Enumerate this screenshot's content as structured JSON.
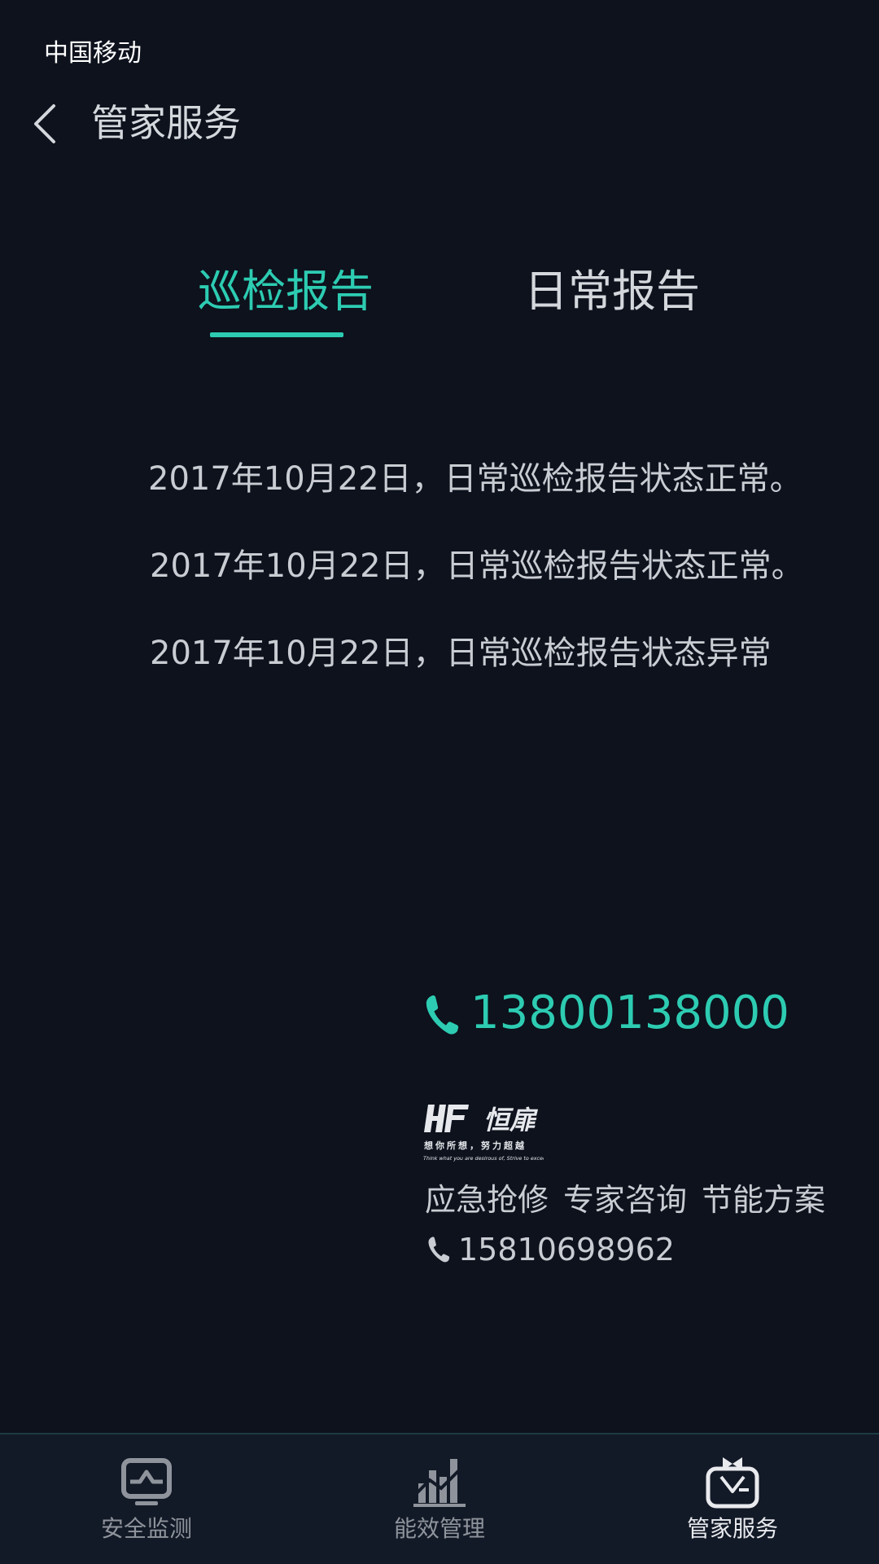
{
  "status_bar": {
    "carrier": "中国移动"
  },
  "header": {
    "title": "管家服务",
    "back_icon": "chevron-left-icon"
  },
  "tabs": [
    {
      "label": "巡检报告",
      "active": true
    },
    {
      "label": "日常报告",
      "active": false
    }
  ],
  "reports": [
    "2017年10月22日，日常巡检报告状态正常。",
    "2017年10月22日，日常巡检报告状态正常。",
    "2017年10月22日，日常巡检报告状态异常"
  ],
  "hotline": {
    "icon": "phone-icon",
    "number": "13800138000"
  },
  "company": {
    "logo_text": "恒扉",
    "slogan": "想你所想，努力超越",
    "slogan_en": "Think what you are desirous of, Strive to exceed",
    "services": [
      "应急抢修",
      "专家咨询",
      "节能方案"
    ],
    "phone": "15810698962"
  },
  "tabbar": [
    {
      "label": "安全监测",
      "icon": "monitor-icon",
      "active": false
    },
    {
      "label": "能效管理",
      "icon": "bar-chart-icon",
      "active": false
    },
    {
      "label": "管家服务",
      "icon": "butler-icon",
      "active": true
    }
  ],
  "colors": {
    "accent": "#2dccb2",
    "background": "#0d121d",
    "text": "#c9ccd2"
  }
}
